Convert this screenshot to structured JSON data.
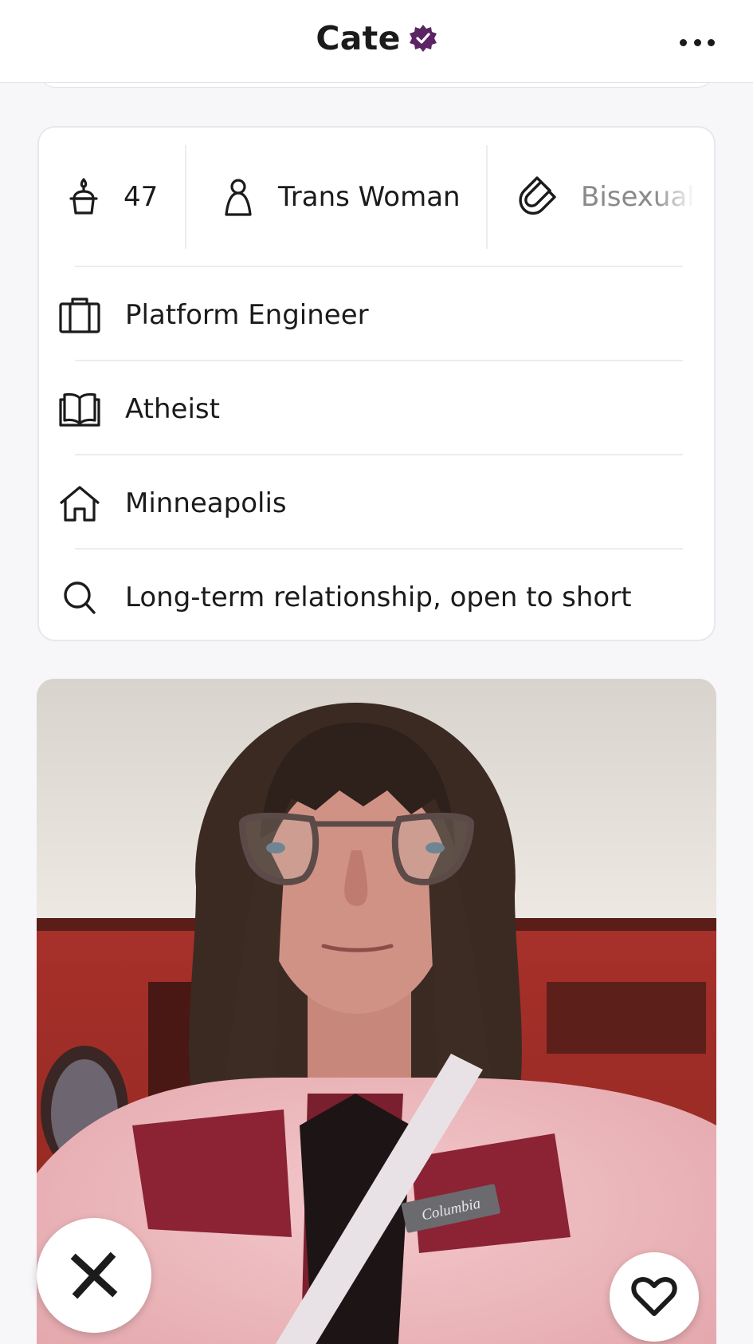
{
  "header": {
    "title": "Cate",
    "verified_icon": "verified-badge-icon",
    "more_icon": "more-options-icon"
  },
  "vitals": {
    "age": {
      "icon": "birthday-cake-icon",
      "label": "47"
    },
    "gender": {
      "icon": "person-icon",
      "label": "Trans Woman"
    },
    "orientation": {
      "icon": "magnet-icon",
      "label": "Bisexual"
    }
  },
  "details": [
    {
      "icon": "briefcase-icon",
      "label": "Platform Engineer"
    },
    {
      "icon": "open-book-icon",
      "label": "Atheist"
    },
    {
      "icon": "home-icon",
      "label": "Minneapolis"
    },
    {
      "icon": "search-icon",
      "label": "Long-term relationship, open to short"
    }
  ],
  "photo": {
    "jacket_logo": "Columbia"
  },
  "actions": {
    "pass_icon": "close-icon",
    "like_icon": "heart-icon"
  },
  "colors": {
    "accent": "#5b2463",
    "text": "#1b1b1b",
    "muted": "#8a8a8a",
    "background": "#f7f6f8",
    "divider": "#ecebef"
  }
}
